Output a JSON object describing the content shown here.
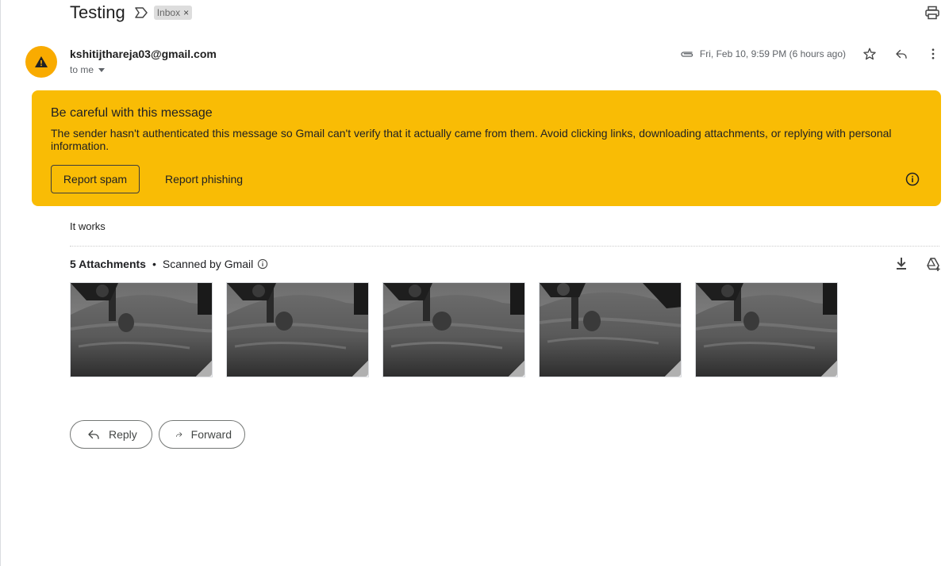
{
  "subject": {
    "title": "Testing",
    "label": "Inbox",
    "label_close": "×"
  },
  "sender": {
    "name": "kshitijthareja03@gmail.com",
    "recipient": "to me",
    "date": "Fri, Feb 10, 9:59 PM (6 hours ago)"
  },
  "warning": {
    "title": "Be careful with this message",
    "body": "The sender hasn't authenticated this message so Gmail can't verify that it actually came from them. Avoid clicking links, downloading attachments, or replying with personal information.",
    "report_spam": "Report spam",
    "report_phishing": "Report phishing"
  },
  "message": {
    "body": "It works"
  },
  "attachments": {
    "count_label": "5 Attachments",
    "separator": "•",
    "scan_label": "Scanned by Gmail",
    "items": [
      "",
      "",
      "",
      "",
      ""
    ]
  },
  "actions": {
    "reply": "Reply",
    "forward": "Forward"
  },
  "colors": {
    "warning_bg": "#f9bc05",
    "avatar_bg": "#f9ab00"
  },
  "icons": [
    "label-importance-icon",
    "print-icon",
    "warning-icon",
    "attachment-icon",
    "star-icon",
    "reply-icon",
    "more-vert-icon",
    "info-icon",
    "download-icon",
    "add-to-drive-icon",
    "forward-icon"
  ]
}
